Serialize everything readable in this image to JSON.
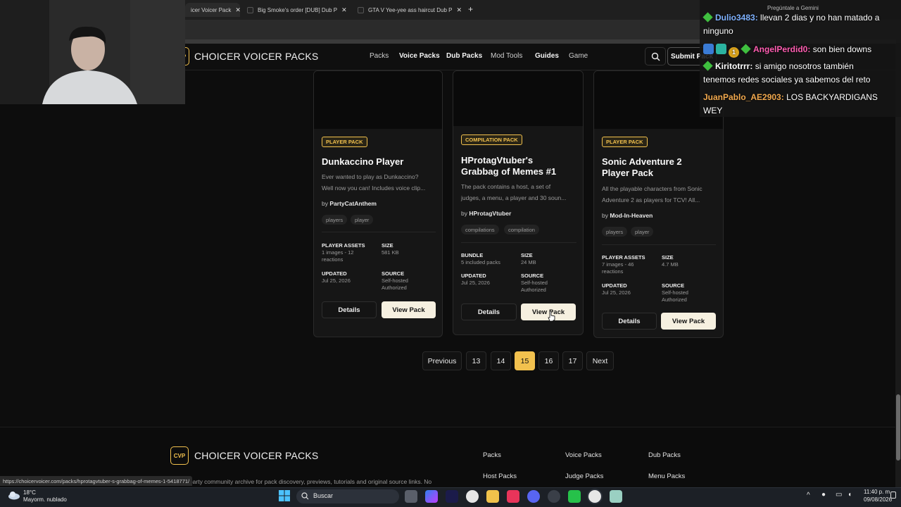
{
  "browser": {
    "tabs": [
      {
        "label": "icer Voicer Pack",
        "active": true
      },
      {
        "label": "Big Smoke's order [DUB] Dub P",
        "active": false
      },
      {
        "label": "GTA V Yee-yee ass haircut Dub P",
        "active": false
      }
    ],
    "new_tab": "+",
    "gemini_hint": "Pregúntale a Gemini"
  },
  "site": {
    "brand": "CHOICER VOICER PACKS",
    "logo_text": "CVP",
    "nav": [
      "Packs",
      "Voice Packs",
      "Dub Packs",
      "Mod Tools",
      "Guides",
      "Game"
    ],
    "submit_label": "Submit Pack"
  },
  "cards": [
    {
      "badge": "PLAYER PACK",
      "title": "Dunkaccino Player",
      "description": [
        "Ever wanted to play as Dunkaccino?",
        "Well now you can! Includes voice clip..."
      ],
      "by_prefix": "by",
      "author": "PartyCatAnthem",
      "tags": [
        "players",
        "player"
      ],
      "meta": [
        {
          "label": "PLAYER ASSETS",
          "value": [
            "1 images - 12",
            "reactions"
          ]
        },
        {
          "label": "SIZE",
          "value": [
            "581 KB"
          ]
        },
        {
          "label": "UPDATED",
          "value": [
            "Jul 25, 2026"
          ]
        },
        {
          "label": "SOURCE",
          "value": [
            "Self-hosted",
            "Authorized"
          ]
        }
      ],
      "details_label": "Details",
      "view_label": "View Pack"
    },
    {
      "badge": "COMPILATION PACK",
      "title": "HProtagVtuber's Grabbag of Memes #1",
      "title_lines": [
        "HProtagVtuber's",
        "Grabbag of Memes #1"
      ],
      "description": [
        "The pack contains a host, a set of",
        "judges, a menu, a player and 30 soun..."
      ],
      "by_prefix": "by",
      "author": "HProtagVtuber",
      "tags": [
        "compilations",
        "compilation"
      ],
      "meta": [
        {
          "label": "BUNDLE",
          "value": [
            "5 included packs"
          ]
        },
        {
          "label": "SIZE",
          "value": [
            "24 MB"
          ]
        },
        {
          "label": "UPDATED",
          "value": [
            "Jul 25, 2026"
          ]
        },
        {
          "label": "SOURCE",
          "value": [
            "Self-hosted",
            "Authorized"
          ]
        }
      ],
      "details_label": "Details",
      "view_label": "View Pack"
    },
    {
      "badge": "PLAYER PACK",
      "title": "Sonic Adventure 2 Player Pack",
      "title_lines": [
        "Sonic Adventure 2",
        "Player Pack"
      ],
      "description": [
        "All the playable characters from Sonic",
        "Adventure 2 as players for TCV! All..."
      ],
      "by_prefix": "by",
      "author": "Mod-In-Heaven",
      "tags": [
        "players",
        "player"
      ],
      "meta": [
        {
          "label": "PLAYER ASSETS",
          "value": [
            "7 images - 46",
            "reactions"
          ]
        },
        {
          "label": "SIZE",
          "value": [
            "4.7 MB"
          ]
        },
        {
          "label": "UPDATED",
          "value": [
            "Jul 25, 2026"
          ]
        },
        {
          "label": "SOURCE",
          "value": [
            "Self-hosted",
            "Authorized"
          ]
        }
      ],
      "details_label": "Details",
      "view_label": "View Pack"
    }
  ],
  "pagination": {
    "previous": "Previous",
    "pages": [
      "13",
      "14",
      "15",
      "16",
      "17"
    ],
    "current": "15",
    "next": "Next"
  },
  "footer": {
    "brand": "CHOICER VOICER PACKS",
    "logo_text": "CVP",
    "links_row1": [
      "Packs",
      "Voice Packs",
      "Dub Packs"
    ],
    "links_row2": [
      "Host Packs",
      "Judge Packs",
      "Menu Packs"
    ],
    "tagline": "A third-party community archive for pack discovery, previews, tutorials and original source links. No"
  },
  "status_url": "https://choicervoicer.com/packs/hprotagvtuber-s-grabbag-of-memes-1-5418771/",
  "chat": [
    {
      "user": "Dulio3483:",
      "user_color": "blue",
      "message": "llevan 2 dias y no han matado a",
      "cont": "ninguno",
      "icons": [
        "gem"
      ]
    },
    {
      "user": "AngelPerdid0:",
      "user_color": "pink",
      "message": "son bien downs",
      "icons": [
        "blue",
        "teal",
        "gold",
        "gem"
      ],
      "gold_text": "1"
    },
    {
      "user": "Kiritotrrr:",
      "user_color": "white",
      "message": "si amigo nosotros también",
      "cont": "tenemos redes sociales ya sabemos del reto",
      "icons": [
        "gem"
      ]
    },
    {
      "user": "JuanPablo_AE2903:",
      "user_color": "gold",
      "message": "LOS BACKYARDIGANS",
      "cont": "WEY",
      "icons": []
    }
  ],
  "taskbar": {
    "temp": "18°C",
    "weather": "Mayorm. nublado",
    "search_placeholder": "Buscar",
    "time": "11:40 p. m.",
    "date": "09/08/2026"
  },
  "colors": {
    "accent": "#f2c14e",
    "bg": "#0d0d0d",
    "card": "#161616"
  }
}
